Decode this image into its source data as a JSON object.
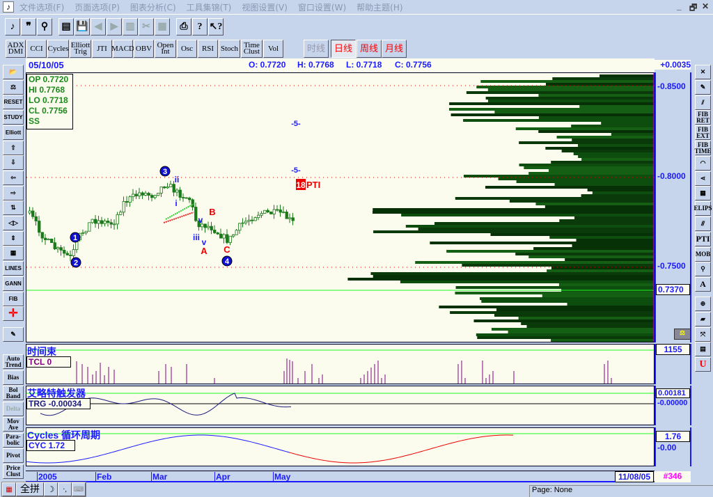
{
  "menu": [
    "文件选项(F)",
    "页面选项(P)",
    "图表分析(C)",
    "工具集锦(T)",
    "视图设置(V)",
    "窗口设置(W)",
    "帮助主题(H)"
  ],
  "window_controls": {
    "minimize": "_",
    "restore": "🗗",
    "close": "✕"
  },
  "indicators": [
    "ADX DMI",
    "CCI",
    "Cycles",
    "Elliott Trig",
    "JTI",
    "MACD",
    "OBV",
    "Open Int",
    "Osc",
    "RSI",
    "Stoch",
    "Time Clust",
    "Vol"
  ],
  "periods": {
    "items": [
      "时线",
      "日线",
      "周线",
      "月线"
    ],
    "selected": "日线"
  },
  "left_tools": [
    "open",
    "balance",
    "RESET",
    "STUDY",
    "Elliott",
    "up",
    "down",
    "left",
    "right",
    "",
    "",
    "",
    "grid",
    "LINES",
    "GANN",
    "FIB",
    "cross",
    "print"
  ],
  "left_studies": [
    "Auto Trend",
    "Bias",
    "Bol Band",
    "Delta",
    "Mov Ave",
    "Para- bolic",
    "Pivot",
    "Price Clust"
  ],
  "right_tools": [
    "X",
    "pencil",
    "lines",
    "FIB RET",
    "FIB EXT",
    "FIB TIME",
    "FIB",
    "fan",
    "grid",
    "ELIPS",
    "channel",
    "PTI",
    "MOB",
    "magnify",
    "A",
    "zoom",
    "eraser",
    "expand",
    "notes",
    "U"
  ],
  "header": {
    "date": "05/10/05",
    "open": "O: 0.7720",
    "high": "H: 0.7768",
    "low": "L: 0.7718",
    "close": "C: 0.7756",
    "change": "+0.0035"
  },
  "ohlc_box": [
    "OP 0.7720",
    "HI  0.7768",
    "LO  0.7718",
    "CL  0.7756",
    "SS"
  ],
  "price_axis": {
    "ticks": [
      "-0.8500",
      "-0.8000",
      "-0.7500"
    ],
    "current": "0.7370"
  },
  "annotations": {
    "waves": [
      "1",
      "2",
      "3",
      "4"
    ],
    "sub": [
      "i",
      "ii",
      "iii",
      "v",
      "v"
    ],
    "abc": [
      "A",
      "B",
      "C"
    ],
    "targets": [
      "-5-",
      "-5-"
    ],
    "pti_num": "18",
    "pti_label": "PTI"
  },
  "panel1": {
    "title": "时间束",
    "value": "TCL 0",
    "axis": "1155"
  },
  "panel2": {
    "title": "艾略特触发器",
    "value": "TRG -0.00034",
    "axis_top": "0.00181",
    "axis_mid": "-0.00000"
  },
  "panel3": {
    "title": "Cycles 循环周期",
    "value": "CYC 1.72",
    "axis_top": "1.76",
    "axis_mid": "-0.00"
  },
  "xaxis": {
    "labels": [
      "2005",
      "Feb",
      "Mar",
      "Apr",
      "May"
    ],
    "end_date": "11/08/05",
    "bar_count": "#346"
  },
  "ime": [
    "全拼"
  ],
  "status": "Page: None"
}
